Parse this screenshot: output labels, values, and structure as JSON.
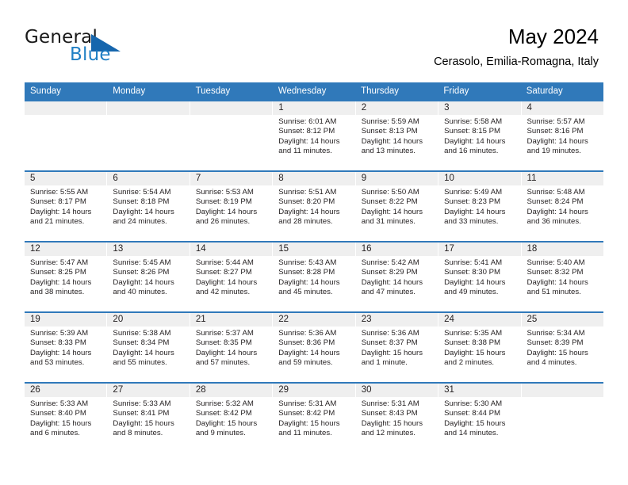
{
  "brand": {
    "name_top": "General",
    "name_bottom": "Blue",
    "triangle_color": "#1666ad",
    "blue_color": "#1f7fc4"
  },
  "header": {
    "month_title": "May 2024",
    "location": "Cerasolo, Emilia-Romagna, Italy"
  },
  "theme": {
    "header_blue": "#3079ba",
    "day_band_gray": "#efefef",
    "text_color": "#231f20"
  },
  "weekdays": [
    "Sunday",
    "Monday",
    "Tuesday",
    "Wednesday",
    "Thursday",
    "Friday",
    "Saturday"
  ],
  "weeks": [
    [
      {
        "day": "",
        "sunrise": "",
        "sunset": "",
        "daylight_a": "",
        "daylight_b": ""
      },
      {
        "day": "",
        "sunrise": "",
        "sunset": "",
        "daylight_a": "",
        "daylight_b": ""
      },
      {
        "day": "",
        "sunrise": "",
        "sunset": "",
        "daylight_a": "",
        "daylight_b": ""
      },
      {
        "day": "1",
        "sunrise": "Sunrise: 6:01 AM",
        "sunset": "Sunset: 8:12 PM",
        "daylight_a": "Daylight: 14 hours",
        "daylight_b": "and 11 minutes."
      },
      {
        "day": "2",
        "sunrise": "Sunrise: 5:59 AM",
        "sunset": "Sunset: 8:13 PM",
        "daylight_a": "Daylight: 14 hours",
        "daylight_b": "and 13 minutes."
      },
      {
        "day": "3",
        "sunrise": "Sunrise: 5:58 AM",
        "sunset": "Sunset: 8:15 PM",
        "daylight_a": "Daylight: 14 hours",
        "daylight_b": "and 16 minutes."
      },
      {
        "day": "4",
        "sunrise": "Sunrise: 5:57 AM",
        "sunset": "Sunset: 8:16 PM",
        "daylight_a": "Daylight: 14 hours",
        "daylight_b": "and 19 minutes."
      }
    ],
    [
      {
        "day": "5",
        "sunrise": "Sunrise: 5:55 AM",
        "sunset": "Sunset: 8:17 PM",
        "daylight_a": "Daylight: 14 hours",
        "daylight_b": "and 21 minutes."
      },
      {
        "day": "6",
        "sunrise": "Sunrise: 5:54 AM",
        "sunset": "Sunset: 8:18 PM",
        "daylight_a": "Daylight: 14 hours",
        "daylight_b": "and 24 minutes."
      },
      {
        "day": "7",
        "sunrise": "Sunrise: 5:53 AM",
        "sunset": "Sunset: 8:19 PM",
        "daylight_a": "Daylight: 14 hours",
        "daylight_b": "and 26 minutes."
      },
      {
        "day": "8",
        "sunrise": "Sunrise: 5:51 AM",
        "sunset": "Sunset: 8:20 PM",
        "daylight_a": "Daylight: 14 hours",
        "daylight_b": "and 28 minutes."
      },
      {
        "day": "9",
        "sunrise": "Sunrise: 5:50 AM",
        "sunset": "Sunset: 8:22 PM",
        "daylight_a": "Daylight: 14 hours",
        "daylight_b": "and 31 minutes."
      },
      {
        "day": "10",
        "sunrise": "Sunrise: 5:49 AM",
        "sunset": "Sunset: 8:23 PM",
        "daylight_a": "Daylight: 14 hours",
        "daylight_b": "and 33 minutes."
      },
      {
        "day": "11",
        "sunrise": "Sunrise: 5:48 AM",
        "sunset": "Sunset: 8:24 PM",
        "daylight_a": "Daylight: 14 hours",
        "daylight_b": "and 36 minutes."
      }
    ],
    [
      {
        "day": "12",
        "sunrise": "Sunrise: 5:47 AM",
        "sunset": "Sunset: 8:25 PM",
        "daylight_a": "Daylight: 14 hours",
        "daylight_b": "and 38 minutes."
      },
      {
        "day": "13",
        "sunrise": "Sunrise: 5:45 AM",
        "sunset": "Sunset: 8:26 PM",
        "daylight_a": "Daylight: 14 hours",
        "daylight_b": "and 40 minutes."
      },
      {
        "day": "14",
        "sunrise": "Sunrise: 5:44 AM",
        "sunset": "Sunset: 8:27 PM",
        "daylight_a": "Daylight: 14 hours",
        "daylight_b": "and 42 minutes."
      },
      {
        "day": "15",
        "sunrise": "Sunrise: 5:43 AM",
        "sunset": "Sunset: 8:28 PM",
        "daylight_a": "Daylight: 14 hours",
        "daylight_b": "and 45 minutes."
      },
      {
        "day": "16",
        "sunrise": "Sunrise: 5:42 AM",
        "sunset": "Sunset: 8:29 PM",
        "daylight_a": "Daylight: 14 hours",
        "daylight_b": "and 47 minutes."
      },
      {
        "day": "17",
        "sunrise": "Sunrise: 5:41 AM",
        "sunset": "Sunset: 8:30 PM",
        "daylight_a": "Daylight: 14 hours",
        "daylight_b": "and 49 minutes."
      },
      {
        "day": "18",
        "sunrise": "Sunrise: 5:40 AM",
        "sunset": "Sunset: 8:32 PM",
        "daylight_a": "Daylight: 14 hours",
        "daylight_b": "and 51 minutes."
      }
    ],
    [
      {
        "day": "19",
        "sunrise": "Sunrise: 5:39 AM",
        "sunset": "Sunset: 8:33 PM",
        "daylight_a": "Daylight: 14 hours",
        "daylight_b": "and 53 minutes."
      },
      {
        "day": "20",
        "sunrise": "Sunrise: 5:38 AM",
        "sunset": "Sunset: 8:34 PM",
        "daylight_a": "Daylight: 14 hours",
        "daylight_b": "and 55 minutes."
      },
      {
        "day": "21",
        "sunrise": "Sunrise: 5:37 AM",
        "sunset": "Sunset: 8:35 PM",
        "daylight_a": "Daylight: 14 hours",
        "daylight_b": "and 57 minutes."
      },
      {
        "day": "22",
        "sunrise": "Sunrise: 5:36 AM",
        "sunset": "Sunset: 8:36 PM",
        "daylight_a": "Daylight: 14 hours",
        "daylight_b": "and 59 minutes."
      },
      {
        "day": "23",
        "sunrise": "Sunrise: 5:36 AM",
        "sunset": "Sunset: 8:37 PM",
        "daylight_a": "Daylight: 15 hours",
        "daylight_b": "and 1 minute."
      },
      {
        "day": "24",
        "sunrise": "Sunrise: 5:35 AM",
        "sunset": "Sunset: 8:38 PM",
        "daylight_a": "Daylight: 15 hours",
        "daylight_b": "and 2 minutes."
      },
      {
        "day": "25",
        "sunrise": "Sunrise: 5:34 AM",
        "sunset": "Sunset: 8:39 PM",
        "daylight_a": "Daylight: 15 hours",
        "daylight_b": "and 4 minutes."
      }
    ],
    [
      {
        "day": "26",
        "sunrise": "Sunrise: 5:33 AM",
        "sunset": "Sunset: 8:40 PM",
        "daylight_a": "Daylight: 15 hours",
        "daylight_b": "and 6 minutes."
      },
      {
        "day": "27",
        "sunrise": "Sunrise: 5:33 AM",
        "sunset": "Sunset: 8:41 PM",
        "daylight_a": "Daylight: 15 hours",
        "daylight_b": "and 8 minutes."
      },
      {
        "day": "28",
        "sunrise": "Sunrise: 5:32 AM",
        "sunset": "Sunset: 8:42 PM",
        "daylight_a": "Daylight: 15 hours",
        "daylight_b": "and 9 minutes."
      },
      {
        "day": "29",
        "sunrise": "Sunrise: 5:31 AM",
        "sunset": "Sunset: 8:42 PM",
        "daylight_a": "Daylight: 15 hours",
        "daylight_b": "and 11 minutes."
      },
      {
        "day": "30",
        "sunrise": "Sunrise: 5:31 AM",
        "sunset": "Sunset: 8:43 PM",
        "daylight_a": "Daylight: 15 hours",
        "daylight_b": "and 12 minutes."
      },
      {
        "day": "31",
        "sunrise": "Sunrise: 5:30 AM",
        "sunset": "Sunset: 8:44 PM",
        "daylight_a": "Daylight: 15 hours",
        "daylight_b": "and 14 minutes."
      },
      {
        "day": "",
        "sunrise": "",
        "sunset": "",
        "daylight_a": "",
        "daylight_b": ""
      }
    ]
  ]
}
